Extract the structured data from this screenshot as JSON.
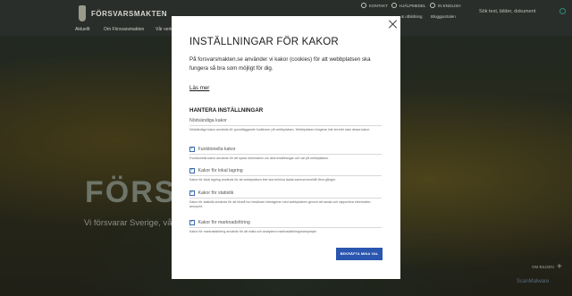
{
  "header": {
    "logo_text": "FÖRSVARSMAKTEN",
    "util_links": [
      {
        "label": "KONTAKT"
      },
      {
        "label": "HJÄLPMEDEL"
      },
      {
        "label": "IN ENGLISH"
      }
    ],
    "secondary_links": [
      "& utbildning",
      "Bloggportalen"
    ],
    "search_placeholder": "Sök text, bilder, dokument",
    "nav": [
      "Aktuellt",
      "Om Försvarsmakten",
      "Vår verk"
    ]
  },
  "hero": {
    "title": "FÖRSVAR",
    "subtitle": "Vi försvarar Sverige, vår",
    "image_credit_label": "OM BILDEN",
    "plus": "+",
    "watermark": "ScanMalware"
  },
  "modal": {
    "title": "INSTÄLLNINGAR FÖR KAKOR",
    "intro": "På forsvarsmakten.se använder vi kakor (cookies) för att webbplatsen ska fungera så bra som möjligt för dig.",
    "read_more": "Läs mer",
    "manage_heading": "HANTERA INSTÄLLNINGAR",
    "options": [
      {
        "label": "Nödvändiga kakor",
        "desc": "Nödvändiga kakor används för grundläggande funktioner på webbplatsen. Webbplatsen fungerar inte korrekt utan dessa kakor.",
        "checkbox": false,
        "checked": false
      },
      {
        "label": "Funktionella kakor",
        "desc": "Funktionella kakor används för att spara information om dina inställningar och val på webbplatsen.",
        "checkbox": true,
        "checked": true
      },
      {
        "label": "Kakor för lokal lagring",
        "desc": "Kakor för lokal lagring används för att webbplatsen inte ska behöva ladda samma innehåll flera gånger.",
        "checkbox": true,
        "checked": true
      },
      {
        "label": "Kakor för statistik",
        "desc": "Kakor för statistik används för att förstå hur besökare interagerar med webbplatsen genom att samla och rapportera information anonymt.",
        "checkbox": true,
        "checked": true
      },
      {
        "label": "Kakor för marknadsföring",
        "desc": "Kakor för marknadsföring används för att mäta och analysera marknadsföringskampanjer.",
        "checkbox": true,
        "checked": true
      }
    ],
    "confirm_label": "BEKRÄFTA MINA VAL"
  }
}
